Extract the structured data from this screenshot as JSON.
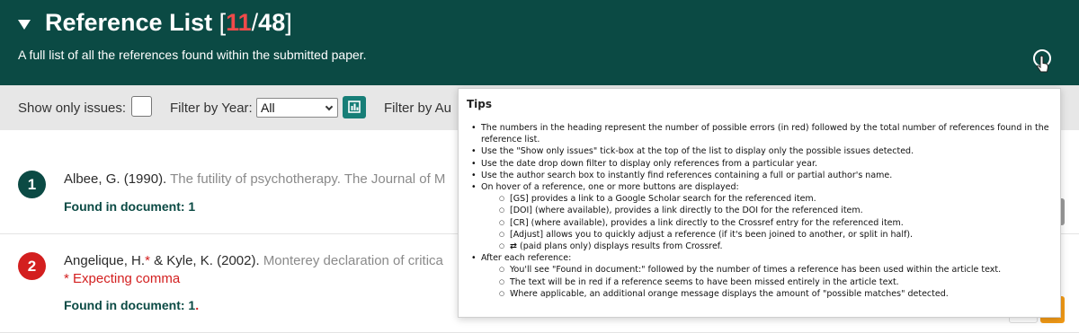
{
  "header": {
    "title": "Reference List",
    "bracket_open": "[",
    "error_count": "11",
    "slash": "/",
    "total_count": "48",
    "bracket_close": "]",
    "subtitle": "A full list of all the references found within the submitted paper.",
    "help_icon": "help-pointer-icon"
  },
  "filters": {
    "show_issues_label": "Show only issues:",
    "year_label": "Filter by Year:",
    "year_selected": "All",
    "author_label": "Filter by Au",
    "chart_icon": "bar-chart-icon"
  },
  "references": [
    {
      "number": "1",
      "status": "ok",
      "authors": "Albee, G. (1990).",
      "rest": "The futility of psychotherapy. The Journal of M",
      "found_label": "Found in document:",
      "found_count": "1"
    },
    {
      "number": "2",
      "status": "issue",
      "authors_part1": "Angelique, H.",
      "asterisk": "*",
      "authors_part2": " & Kyle, K. (2002).",
      "rest": "Monterey declaration of critica",
      "issue": "* Expecting comma",
      "found_label": "Found in document:",
      "found_count": "1",
      "found_suffix": "."
    }
  ],
  "tips": {
    "title": "Tips",
    "items": [
      "The numbers in the heading represent the number of possible errors (in red) followed by the total number of references found in the reference list.",
      "Use the \"Show only issues\" tick-box at the top of the list to display only the possible issues detected.",
      "Use the date drop down filter to display only references from a particular year.",
      "Use the author search box to instantly find references containing a full or partial author's name.",
      "On hover of a reference, one or more buttons are displayed:",
      "After each reference:"
    ],
    "hover_sub": [
      "[GS] provides a link to a Google Scholar search for the referenced item.",
      "[DOI] (where available), provides a link directly to the DOI for the referenced item.",
      "[CR] (where available), provides a link directly to the Crossref entry for the referenced item.",
      "[Adjust] allows you to quickly adjust a reference (if it's been joined to another, or split in half).",
      "(paid plans only) displays results from Crossref."
    ],
    "swap_glyph": "⇄",
    "after_sub": [
      "You'll see \"Found in document:\" followed by the number of times a reference has been used within the article text.",
      "The text will be in red if a reference seems to have been missed entirely in the article text.",
      "Where applicable, an additional orange message displays the amount of \"possible matches\" detected."
    ]
  },
  "colors": {
    "header_bg": "#0b4a44",
    "error_red": "#d31f1f",
    "accent_teal": "#177e77",
    "orange": "#f29a16"
  }
}
